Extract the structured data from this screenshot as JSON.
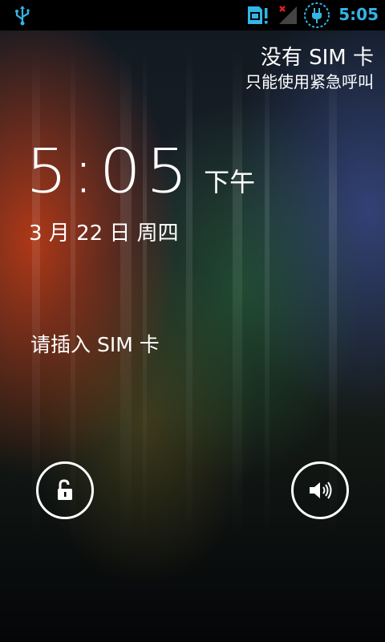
{
  "status_bar": {
    "time": "5:05",
    "icons": [
      "usb-icon",
      "sim-missing-icon",
      "no-signal-icon",
      "battery-charging-icon"
    ],
    "accent_color": "#33b5e5"
  },
  "carrier": {
    "line1": "没有 SIM 卡",
    "line2": "只能使用紧急呼叫"
  },
  "clock": {
    "time": "5:05",
    "ampm": "下午"
  },
  "date": "3 月 22 日 周四",
  "sim_message": "请插入 SIM 卡",
  "controls": {
    "unlock_icon": "unlock-icon",
    "sound_icon": "sound-on-icon"
  }
}
